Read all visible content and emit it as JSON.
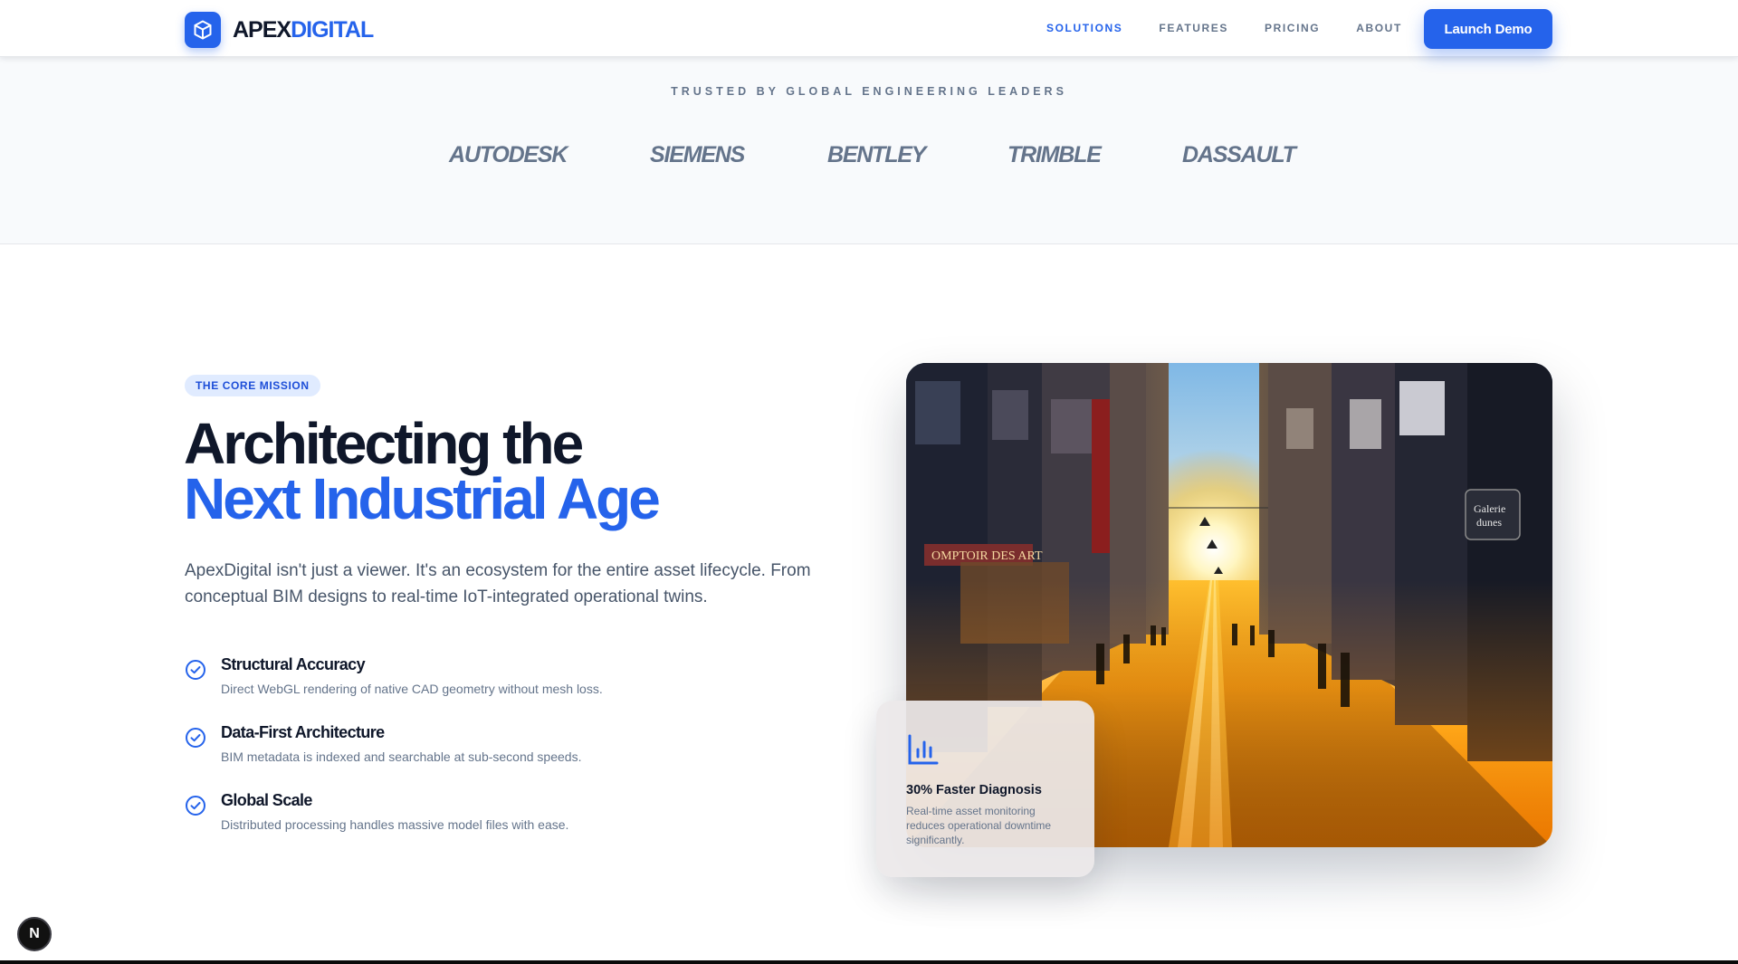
{
  "nav": {
    "logo_left": "APEX",
    "logo_right": "DIGITAL",
    "links": [
      "SOLUTIONS",
      "FEATURES",
      "PRICING",
      "ABOUT"
    ],
    "active_link": "SOLUTIONS",
    "cta_label": "Launch Demo"
  },
  "trusted": {
    "title": "TRUSTED BY GLOBAL ENGINEERING LEADERS",
    "brands": [
      "AUTODESK",
      "SIEMENS",
      "BENTLEY",
      "TRIMBLE",
      "DASSAULT"
    ]
  },
  "mission": {
    "badge": "THE CORE MISSION",
    "headline_line1": "Architecting the",
    "headline_line2": "Next Industrial Age",
    "lead": "ApexDigital isn't just a viewer. It's an ecosystem for the entire asset lifecycle. From conceptual BIM designs to real-time IoT-integrated operational twins.",
    "features": [
      {
        "title": "Structural Accuracy",
        "desc": "Direct WebGL rendering of native CAD geometry without mesh loss."
      },
      {
        "title": "Data-First Architecture",
        "desc": "BIM metadata is indexed and searchable at sub-second speeds."
      },
      {
        "title": "Global Scale",
        "desc": "Distributed processing handles massive model files with ease."
      }
    ]
  },
  "stat_card": {
    "icon": "bar-chart-icon",
    "title": "30% Faster Diagnosis",
    "desc": "Real-time asset monitoring reduces operational downtime significantly."
  },
  "misc": {
    "corner_badge": "N"
  },
  "colors": {
    "primary": "#2563eb",
    "text_dark": "#0f172a",
    "text_muted": "#64748b",
    "section_bg": "#f8fafc"
  }
}
